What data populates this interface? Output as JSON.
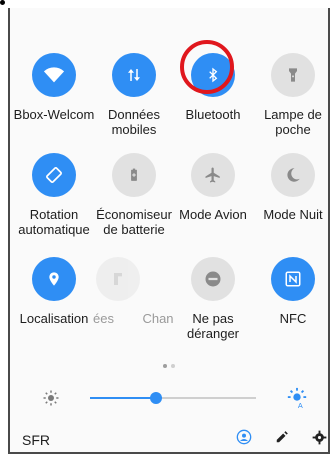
{
  "tiles": [
    {
      "id": "wifi",
      "label": "Bbox-Welcom",
      "icon": "wifi-icon",
      "state": "on"
    },
    {
      "id": "mobile-data",
      "label": "Données mobiles",
      "icon": "mobile-data-icon",
      "state": "on"
    },
    {
      "id": "bluetooth",
      "label": "Bluetooth",
      "icon": "bluetooth-icon",
      "state": "on"
    },
    {
      "id": "flashlight",
      "label": "Lampe de poche",
      "icon": "flashlight-icon",
      "state": "off"
    },
    {
      "id": "rotation",
      "label": "Rotation automatique",
      "icon": "auto-rotate-icon",
      "state": "on"
    },
    {
      "id": "battery-saver",
      "label": "Économiseur de batterie",
      "icon": "battery-saver-icon",
      "state": "off"
    },
    {
      "id": "airplane",
      "label": "Mode Avion",
      "icon": "airplane-icon",
      "state": "off"
    },
    {
      "id": "night-mode",
      "label": "Mode Nuit",
      "icon": "night-mode-icon",
      "state": "off"
    },
    {
      "id": "location",
      "label": "Localisation",
      "icon": "location-icon",
      "state": "on"
    },
    {
      "id": "partial-1",
      "label": "ées",
      "icon": "faded-icon",
      "state": "faded"
    },
    {
      "id": "partial-2",
      "label": "Chan",
      "icon": "faded-icon",
      "state": "faded"
    },
    {
      "id": "dnd",
      "label": "Ne pas déranger",
      "icon": "do-not-disturb-icon",
      "state": "off"
    },
    {
      "id": "nfc",
      "label": "NFC",
      "icon": "nfc-icon",
      "state": "on"
    }
  ],
  "brightness": {
    "level": 0.4
  },
  "footer": {
    "carrier": "SFR",
    "icons": [
      "user-icon",
      "edit-icon",
      "settings-icon"
    ]
  },
  "pager": {
    "pages": 2,
    "current": 0
  },
  "colors": {
    "accent": "#2f8ef4",
    "inactive": "#e1e1e1",
    "highlight": "#e0171d"
  }
}
